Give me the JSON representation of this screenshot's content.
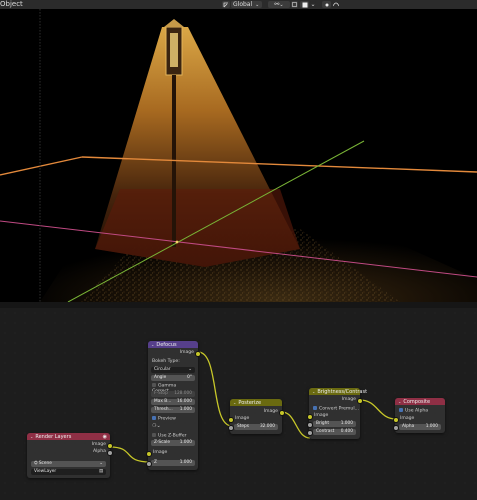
{
  "topbar": {
    "mode_label": "Object",
    "transform_orientation": "Global",
    "colors": {
      "bar": "#2b2b2b",
      "button": "#3c3c3c"
    }
  },
  "viewport": {
    "colors": {
      "background": "#000000",
      "x_axis": "#e3893b",
      "y_axis": "#79b436",
      "z_line": "#c04a83",
      "light": "#d48b2a"
    }
  },
  "nodes": {
    "render_layers": {
      "title": "Render Layers",
      "color": "#8f2f45",
      "outputs": [
        "Image",
        "Alpha"
      ],
      "scene": "Scene",
      "view_layer": "ViewLayer"
    },
    "defocus": {
      "title": "Defocus",
      "color": "#563f8b",
      "output": "Image",
      "bokeh_type_label": "Bokeh Type:",
      "bokeh_type": "Circular",
      "angle_label": "Angle",
      "angle_value": "0°",
      "gamma_label": "Gamma Correct...",
      "fstop_label": "F-Stop",
      "fstop_value": "128.000",
      "maxblur_label": "Max B...",
      "maxblur_value": "16.000",
      "threshold_label": "Thresh...",
      "threshold_value": "1.000",
      "preview_label": "Preview",
      "use_zbuffer_label": "Use Z-Buffer",
      "zscale_label": "Z-Scale",
      "zscale_value": "1.000",
      "input_image": "Image",
      "z_label": "Z",
      "z_value": "1.000"
    },
    "posterize": {
      "title": "Posterize",
      "color": "#6a6a10",
      "output": "Image",
      "input": "Image",
      "steps_label": "Steps",
      "steps_value": "32.000"
    },
    "brightness_contrast": {
      "title": "Brightness/Contrast",
      "color": "#6a6a10",
      "output": "Image",
      "convert_label": "Convert Premul...",
      "input": "Image",
      "bright_label": "Bright",
      "bright_value": "1.000",
      "contrast_label": "Contrast",
      "contrast_value": "0.400"
    },
    "composite": {
      "title": "Composite",
      "color": "#8f2f45",
      "use_alpha_label": "Use Alpha",
      "input": "Image",
      "alpha_label": "Alpha",
      "alpha_value": "1.000"
    }
  }
}
